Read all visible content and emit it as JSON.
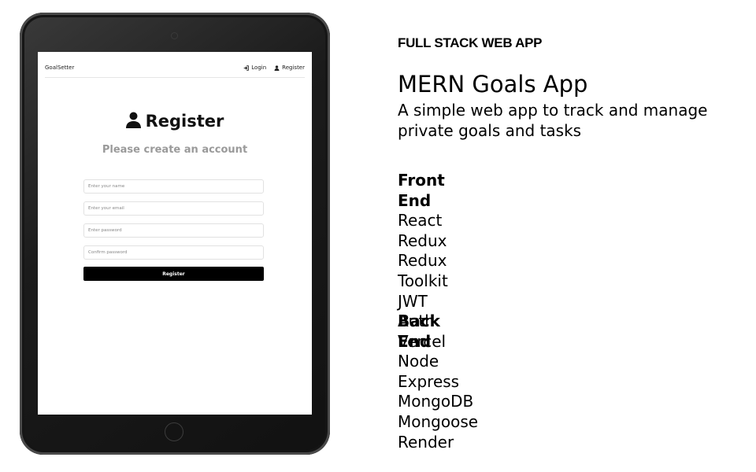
{
  "tablet": {
    "app": {
      "brand": "GoalSetter",
      "nav": [
        {
          "icon": "sign-in-icon",
          "label": "Login"
        },
        {
          "icon": "user-icon",
          "label": "Register"
        }
      ],
      "heading": "Register",
      "subheading": "Please create an account",
      "form": {
        "name_placeholder": "Enter your name",
        "email_placeholder": "Enter your email",
        "password_placeholder": "Enter password",
        "confirm_placeholder": "Confirm password",
        "submit_label": "Register"
      }
    }
  },
  "info": {
    "eyebrow": "FULL STACK WEB APP",
    "title": "MERN Goals App",
    "description": "A simple web app to track and manage private goals and tasks",
    "front_end": {
      "heading": "Front End",
      "items": [
        "React",
        "Redux",
        "Redux Toolkit",
        "JWT Auth",
        "Vercel"
      ]
    },
    "back_end": {
      "heading": "Back End",
      "items": [
        "Node",
        "Express",
        "MongoDB",
        "Mongoose",
        "Render"
      ]
    }
  }
}
